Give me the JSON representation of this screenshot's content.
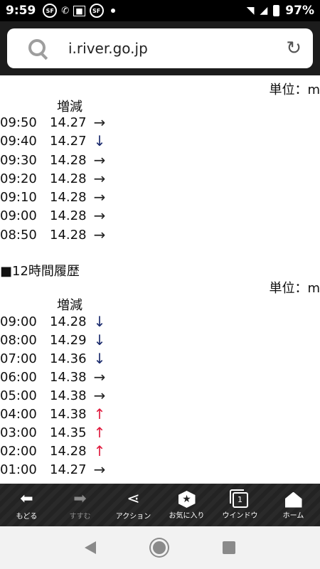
{
  "status_bar": {
    "time": "9:59",
    "battery": "97%",
    "notification_icons": [
      "SF",
      "SF"
    ]
  },
  "browser": {
    "url": "i.river.go.jp"
  },
  "section1": {
    "title": "",
    "unit": "単位：m",
    "column_header": "増減",
    "rows": [
      {
        "time": "09:50",
        "value": "14.27",
        "trend": "→"
      },
      {
        "time": "09:40",
        "value": "14.27",
        "trend": "↓"
      },
      {
        "time": "09:30",
        "value": "14.28",
        "trend": "→"
      },
      {
        "time": "09:20",
        "value": "14.28",
        "trend": "→"
      },
      {
        "time": "09:10",
        "value": "14.28",
        "trend": "→"
      },
      {
        "time": "09:00",
        "value": "14.28",
        "trend": "→"
      },
      {
        "time": "08:50",
        "value": "14.28",
        "trend": "→"
      }
    ]
  },
  "section2": {
    "title": "■12時間履歴",
    "unit": "単位：m",
    "column_header": "増減",
    "rows": [
      {
        "time": "09:00",
        "value": "14.28",
        "trend": "↓"
      },
      {
        "time": "08:00",
        "value": "14.29",
        "trend": "↓"
      },
      {
        "time": "07:00",
        "value": "14.36",
        "trend": "↓"
      },
      {
        "time": "06:00",
        "value": "14.38",
        "trend": "→"
      },
      {
        "time": "05:00",
        "value": "14.38",
        "trend": "→"
      },
      {
        "time": "04:00",
        "value": "14.38",
        "trend": "↑"
      },
      {
        "time": "03:00",
        "value": "14.35",
        "trend": "↑"
      },
      {
        "time": "02:00",
        "value": "14.28",
        "trend": "↑"
      },
      {
        "time": "01:00",
        "value": "14.27",
        "trend": "→"
      }
    ]
  },
  "toolbar": {
    "back": "もどる",
    "forward": "すすむ",
    "action": "アクション",
    "favorites": "お気に入り",
    "window": "ウインドウ",
    "window_count": "1",
    "home": "ホーム"
  },
  "colors": {
    "trend_up": "#e0183c",
    "trend_down": "#1a2a6c",
    "trend_flat": "#222222"
  }
}
